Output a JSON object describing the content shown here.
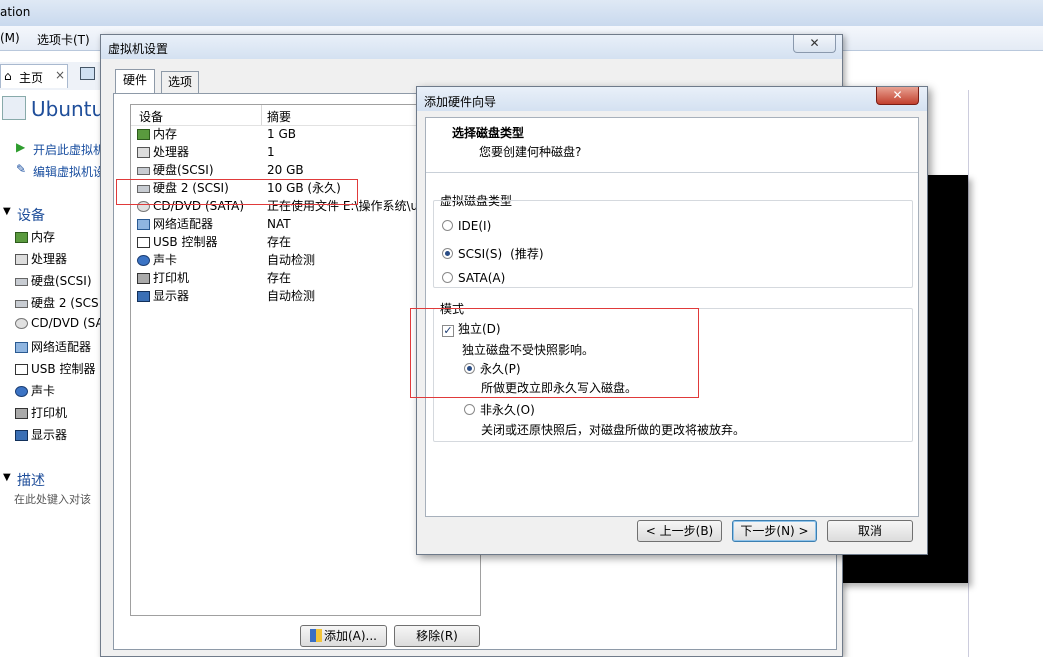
{
  "bg": {
    "title_partial": "ation",
    "menu": [
      "(M)",
      "选项卡(T)"
    ],
    "home_tab": "主页",
    "vm_name": "Ubuntu",
    "actions": [
      "开启此虚拟机",
      "编辑虚拟机设"
    ],
    "devices_header": "设备",
    "devices": [
      "内存",
      "处理器",
      "硬盘(SCSI)",
      "硬盘 2 (SCS",
      "CD/DVD (SA",
      "网络适配器",
      "USB 控制器",
      "声卡",
      "打印机",
      "显示器"
    ],
    "desc_header": "描述",
    "desc_placeholder": "在此处键入对该"
  },
  "settings": {
    "title": "虚拟机设置",
    "tabs": [
      "硬件",
      "选项"
    ],
    "col_device": "设备",
    "col_summary": "摘要",
    "rows": [
      {
        "device": "内存",
        "summary": "1 GB",
        "icon": "memory-icon"
      },
      {
        "device": "处理器",
        "summary": "1",
        "icon": "cpu-icon"
      },
      {
        "device": "硬盘(SCSI)",
        "summary": "20 GB",
        "icon": "disk-icon"
      },
      {
        "device": "硬盘 2 (SCSI)",
        "summary": "10 GB (永久)",
        "icon": "disk-icon"
      },
      {
        "device": "CD/DVD (SATA)",
        "summary": "正在使用文件 E:\\操作系统\\u",
        "icon": "cd-icon"
      },
      {
        "device": "网络适配器",
        "summary": "NAT",
        "icon": "network-icon"
      },
      {
        "device": "USB 控制器",
        "summary": "存在",
        "icon": "usb-icon"
      },
      {
        "device": "声卡",
        "summary": "自动检测",
        "icon": "sound-icon"
      },
      {
        "device": "打印机",
        "summary": "存在",
        "icon": "printer-icon"
      },
      {
        "device": "显示器",
        "summary": "自动检测",
        "icon": "monitor-icon"
      }
    ],
    "add_button": "添加(A)...",
    "remove_button": "移除(R)"
  },
  "wizard": {
    "title": "添加硬件向导",
    "heading": "选择磁盘类型",
    "subheading": "您要创建何种磁盘?",
    "disk_type_group": "虚拟磁盘类型",
    "opt_ide": "IDE(I)",
    "opt_scsi": "SCSI(S)",
    "opt_scsi_note": "(推荐)",
    "opt_sata": "SATA(A)",
    "mode_group": "模式",
    "independent": "独立(D)",
    "independent_desc": "独立磁盘不受快照影响。",
    "persistent": "永久(P)",
    "persistent_desc": "所做更改立即永久写入磁盘。",
    "nonpersistent": "非永久(O)",
    "nonpersistent_desc": "关闭或还原快照后，对磁盘所做的更改将被放弃。",
    "back": "< 上一步(B)",
    "next": "下一步(N) >",
    "cancel": "取消"
  }
}
